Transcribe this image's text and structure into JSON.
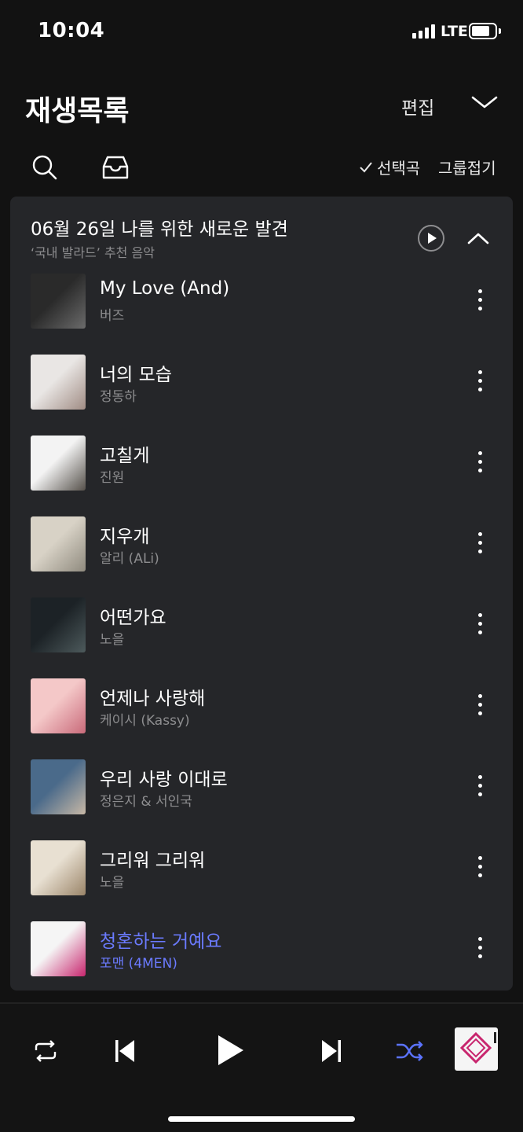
{
  "status": {
    "time": "10:04",
    "network": "LTE"
  },
  "header": {
    "title": "재생목록",
    "edit_label": "편집"
  },
  "toolbar": {
    "select_label": "선택곡",
    "fold_label": "그룹접기"
  },
  "group": {
    "title": "06월 26일 나를 위한 새로운 발견",
    "subtitle": "‘국내 발라드’ 추천 음악"
  },
  "tracks": [
    {
      "title": "My Love (And)",
      "artist": "버즈",
      "art_colors": [
        "#2a2a2a",
        "#6b6b6b"
      ],
      "active": false
    },
    {
      "title": "너의 모습",
      "artist": "정동하",
      "art_colors": [
        "#e9e6e4",
        "#a08c84"
      ],
      "active": false
    },
    {
      "title": "고칠게",
      "artist": "진원",
      "art_colors": [
        "#f3f3f3",
        "#55504a"
      ],
      "active": false
    },
    {
      "title": "지우개",
      "artist": "알리 (ALi)",
      "art_colors": [
        "#d8d2c6",
        "#8f8a7e"
      ],
      "active": false
    },
    {
      "title": "어떤가요",
      "artist": "노을",
      "art_colors": [
        "#1c2226",
        "#4d5a5c"
      ],
      "active": false
    },
    {
      "title": "언제나 사랑해",
      "artist": "케이시 (Kassy)",
      "art_colors": [
        "#f4c8c8",
        "#c96a7a"
      ],
      "active": false
    },
    {
      "title": "우리 사랑 이대로",
      "artist": "정은지 & 서인국",
      "art_colors": [
        "#4a6a8a",
        "#c8b8a6"
      ],
      "active": false
    },
    {
      "title": "그리워 그리워",
      "artist": "노을",
      "art_colors": [
        "#e8e0d2",
        "#9a8468"
      ],
      "active": false
    },
    {
      "title": "청혼하는 거예요",
      "artist": "포맨 (4MEN)",
      "art_colors": [
        "#f5f5f5",
        "#c8266e"
      ],
      "active": true
    }
  ],
  "colors": {
    "accent": "#6b7bff",
    "card_bg": "#252629",
    "page_bg": "#121212"
  }
}
